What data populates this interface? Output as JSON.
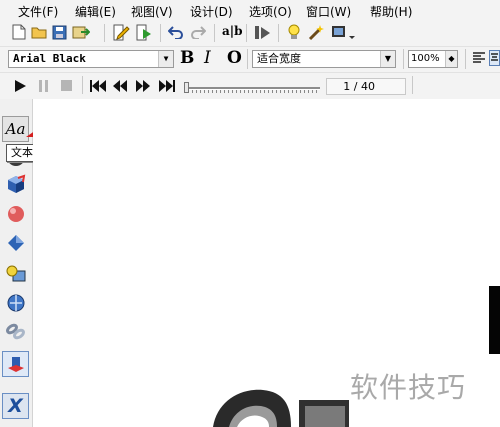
{
  "menu": [
    "文件(F)",
    "编辑(E)",
    "视图(V)",
    "设计(D)",
    "选项(O)",
    "窗口(W)",
    "帮助(H)"
  ],
  "font_combo": {
    "value": "Arial Black"
  },
  "format": {
    "bold": "B",
    "italic": "I",
    "outline": "O"
  },
  "fit_combo": {
    "value": "适合宽度"
  },
  "zoom": {
    "value": "100%"
  },
  "playback": {
    "frame_counter": "1 / 40",
    "position_fraction": 0.0
  },
  "toolbar_icons": [
    "new-icon",
    "open-icon",
    "save-icon",
    "export-icon",
    "edit-icon",
    "play-edit-icon",
    "undo-icon",
    "redo-icon",
    "spell-icon",
    "render-icon",
    "light-icon",
    "wand-icon",
    "display-icon"
  ],
  "left_tools": {
    "text_button_label": "Aa",
    "tooltip": "文本选项 (Alt+T)",
    "icons": [
      "globe-icon",
      "cube-icon",
      "sphere-icon",
      "diamond-icon",
      "shapes-icon",
      "ball-icon",
      "chain-icon",
      "active-tool-icon",
      "x-logo-icon"
    ]
  },
  "watermark": "软件技巧"
}
